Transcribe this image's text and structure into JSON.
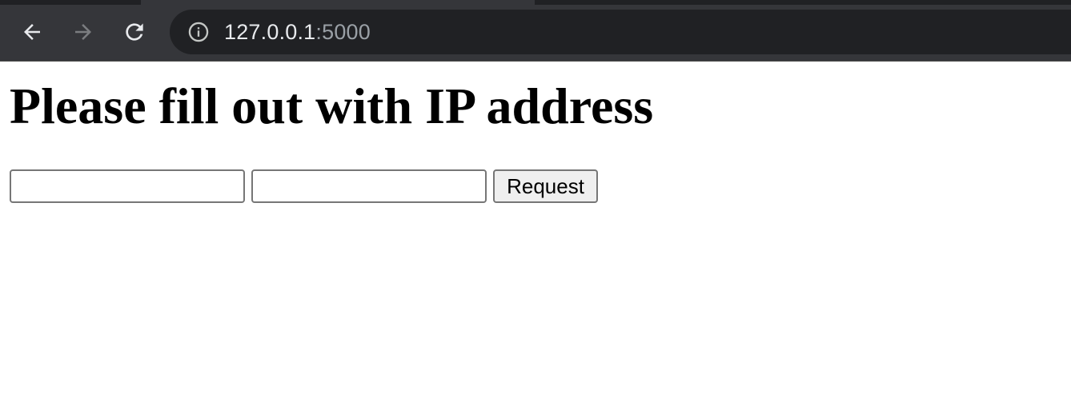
{
  "browser": {
    "url_host": "127.0.0.1",
    "url_port": ":5000",
    "icons": {
      "back": "back-arrow-icon",
      "forward": "forward-arrow-icon",
      "reload": "reload-icon",
      "info": "info-icon"
    },
    "colors": {
      "toolbar": "#35363a",
      "omnibox": "#202124",
      "url_host": "#e8eaed",
      "url_port": "#9aa0a6"
    }
  },
  "page": {
    "title": "Please fill out with IP address",
    "input_1": {
      "value": "",
      "placeholder": ""
    },
    "input_2": {
      "value": "",
      "placeholder": ""
    },
    "request_label": "Request"
  }
}
